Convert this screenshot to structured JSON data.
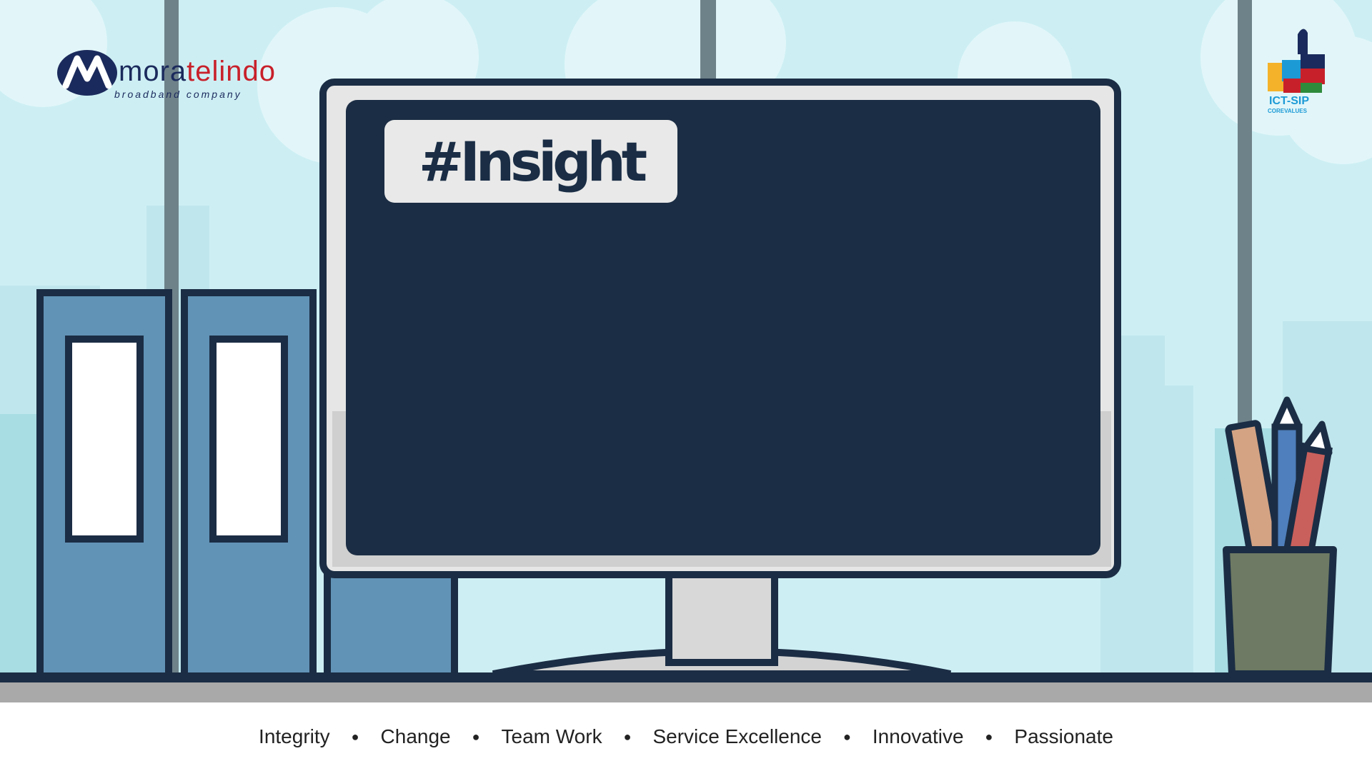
{
  "logo_left": {
    "brand_part1": "mora",
    "brand_part2": "telindo",
    "tagline": "broadband company"
  },
  "logo_right": {
    "brand": "ICT-SIP",
    "sub": "COREVALUES"
  },
  "screen": {
    "hashtag": "#Insight"
  },
  "core_values": [
    "Integrity",
    "Change",
    "Team Work",
    "Service Excellence",
    "Innovative",
    "Passionate"
  ],
  "colors": {
    "navy": "#1b2d44",
    "sky": "#cdeff4",
    "binder": "#6193b6",
    "brand_red": "#c8202a"
  }
}
